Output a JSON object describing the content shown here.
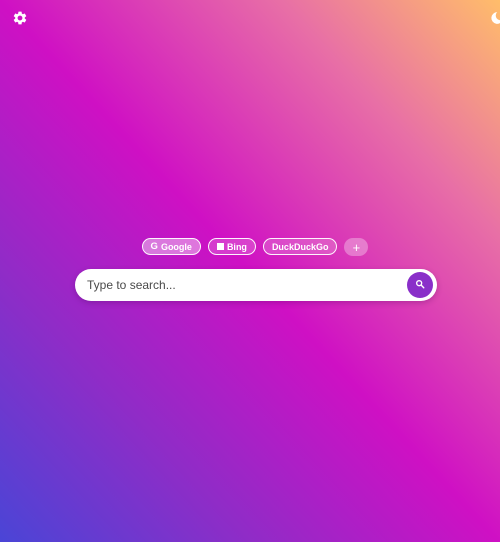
{
  "toolbar": {
    "settings_icon": "gear-icon",
    "theme_icon": "moon-icon"
  },
  "engines": [
    {
      "label": "Google",
      "icon": "google-g-icon",
      "glyph": "G",
      "active": true
    },
    {
      "label": "Bing",
      "icon": "bing-square-icon",
      "active": false
    },
    {
      "label": "DuckDuckGo",
      "active": false
    }
  ],
  "add_engine": {
    "label": "+"
  },
  "search": {
    "placeholder": "Type to search...",
    "value": "",
    "button_icon": "search-icon"
  },
  "colors": {
    "gradient_bottom_left": "#4a45d6",
    "gradient_mid": "#cf10c4",
    "gradient_top_right": "#ffbd6a",
    "search_button": "#8a2fc9"
  }
}
